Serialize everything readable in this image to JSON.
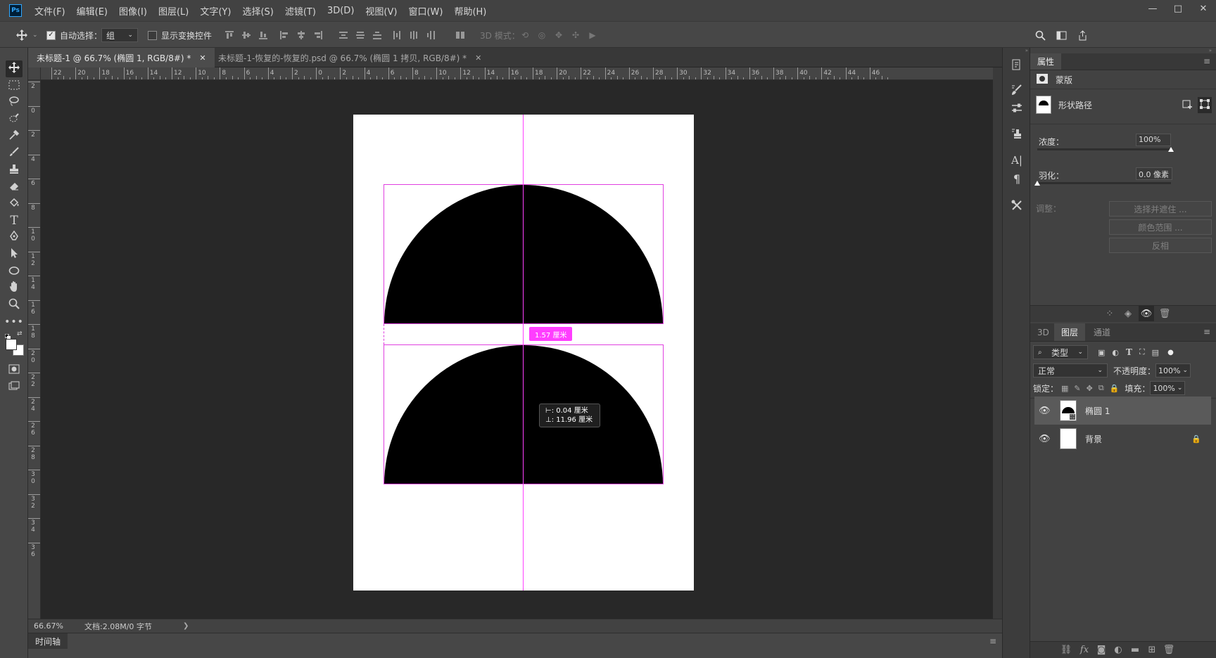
{
  "app": {
    "logo": "Ps"
  },
  "menu": [
    "文件(F)",
    "编辑(E)",
    "图像(I)",
    "图层(L)",
    "文字(Y)",
    "选择(S)",
    "滤镜(T)",
    "3D(D)",
    "视图(V)",
    "窗口(W)",
    "帮助(H)"
  ],
  "window_controls": [
    "—",
    "□",
    "✕"
  ],
  "options": {
    "auto_select_label": "自动选择：",
    "auto_select_checked": true,
    "auto_select_value": "组",
    "show_transform_label": "显示变换控件",
    "show_transform_checked": false,
    "mode_3d_label": "3D 模式："
  },
  "tabs": [
    {
      "label": "未标题-1 @ 66.7% (椭圆 1, RGB/8#) *",
      "close": "✕",
      "active": true
    },
    {
      "label": "未标题-1-恢复的-恢复的.psd @ 66.7% (椭圆 1 拷贝, RGB/8#) *",
      "close": "✕",
      "active": false
    }
  ],
  "ruler_h": [
    "22",
    "20",
    "18",
    "16",
    "14",
    "12",
    "10",
    "8",
    "6",
    "4",
    "2",
    "0",
    "2",
    "4",
    "6",
    "8",
    "10",
    "12",
    "14",
    "16",
    "18",
    "20",
    "22",
    "24",
    "26",
    "28",
    "30",
    "32",
    "34",
    "36",
    "38",
    "40",
    "42",
    "44",
    "46"
  ],
  "ruler_v": [
    "2",
    "0",
    "2",
    "4",
    "6",
    "8",
    "1 0",
    "1 2",
    "1 4",
    "1 6",
    "1 8",
    "2 0",
    "2 2",
    "2 4",
    "2 6",
    "2 8",
    "3 0",
    "3 2",
    "3 4",
    "3 6"
  ],
  "canvas": {
    "distance_label": "1.57 厘米",
    "coord_tip": {
      "line1": "⊢:    0.04 厘米",
      "line2": "⊥:  11.96 厘米"
    }
  },
  "status": {
    "zoom": "66.67%",
    "doc_info": "文档:2.08M/0 字节",
    "arrow": "❯"
  },
  "timeline": {
    "label": "时间轴",
    "menu_icon": "≡"
  },
  "properties": {
    "title": "属性",
    "mask_label": "蒙版",
    "shape_path_label": "形状路径",
    "density_label": "浓度：",
    "density_value": "100%",
    "density_level": 1.0,
    "feather_label": "羽化：",
    "feather_value": "0.0 像素",
    "feather_level": 0.0,
    "adjust_label": "调整：",
    "buttons": [
      "选择并遮住 ...",
      "颜色范围 ...",
      "反相"
    ]
  },
  "layers_panel": {
    "tabs": [
      "3D",
      "图层",
      "通道"
    ],
    "active_tab": 1,
    "filter_value": "类型",
    "blend_mode": "正常",
    "opacity_label": "不透明度：",
    "opacity_value": "100%",
    "lock_label": "锁定：",
    "fill_label": "填充：",
    "fill_value": "100%",
    "layers": [
      {
        "name": "椭圆 1",
        "selected": true
      },
      {
        "name": "背景",
        "selected": false,
        "locked": true
      }
    ]
  }
}
